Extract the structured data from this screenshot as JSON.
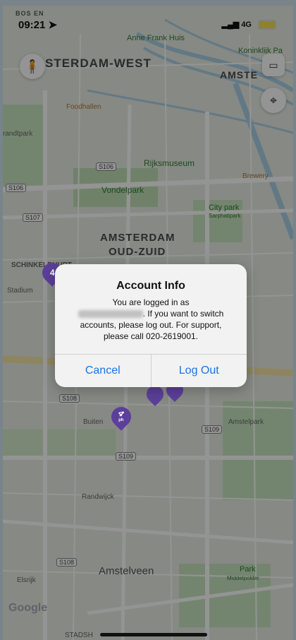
{
  "status": {
    "carrier": "BOS EN",
    "time": "09:21",
    "network": "4G"
  },
  "map": {
    "labels": {
      "amsterdam_west": "STERDAM-WEST",
      "amsterdam_center": "AMSTE",
      "anne_frank": "Anne Frank Huis",
      "koninklijk": "Koninklijk Pa",
      "foodhallen": "Foodhallen",
      "randtpark": "randtpark",
      "rijksmuseum": "Rijksmuseum",
      "vondelpark": "Vondelpark",
      "brewery": "Brewery",
      "city_park": "City park",
      "sarphatipark": "Sarphatipark",
      "oud_zuid_1": "AMSTERDAM",
      "oud_zuid_2": "OUD-ZUID",
      "schinkel": "SCHINKELBUURT",
      "stadium": "Stadium",
      "buitenveldert": "Buiten",
      "amstelpark": "Amstelpark",
      "randwijck": "Randwijck",
      "amstelveen": "Amstelveen",
      "park": "Park",
      "middelpolder": "Middelpolder",
      "elsrijk": "Elsrijk",
      "stadsh": "STADSH",
      "google": "Google"
    },
    "roads": {
      "s106a": "S106",
      "s106b": "S106",
      "s107": "S107",
      "s108": "S108",
      "s109": "S109",
      "s109b": "S109",
      "s108b": "S108"
    },
    "markers": [
      {
        "count": "4",
        "unit": "ph"
      },
      {
        "count": "4",
        "unit": "ph"
      }
    ]
  },
  "alert": {
    "title": "Account Info",
    "line1": "You are logged in as",
    "line2": ". If you want to switch accounts, please log out. For support, please call 020-2619001.",
    "cancel": "Cancel",
    "logout": "Log Out"
  }
}
